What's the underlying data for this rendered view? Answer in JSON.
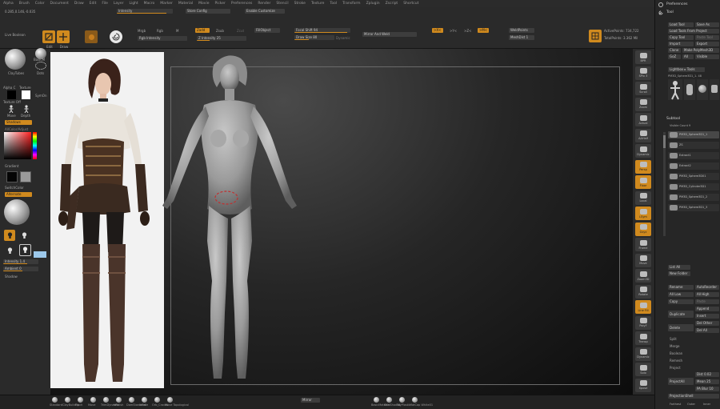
{
  "menu": {
    "items": [
      "Alpha",
      "Brush",
      "Color",
      "Document",
      "Draw",
      "Edit",
      "File",
      "Layer",
      "Light",
      "Macro",
      "Marker",
      "Material",
      "Movie",
      "Picker",
      "Preferences",
      "Render",
      "Stencil",
      "Stroke",
      "Texture",
      "Tool",
      "Transform",
      "Zplugin",
      "Zscript",
      "Shortcut"
    ]
  },
  "shelf": {
    "coords": "0.285,0.146,-0.035",
    "zintensity_label": "Intensity",
    "config_label": "Store Config",
    "enable_customize": "Enable Customize",
    "edit_label": "Edit",
    "draw_label": "Draw",
    "mrgb": "Mrgb",
    "rgb": "Rgb",
    "m": "M",
    "zadd": "Zadd",
    "zsub": "Zsub",
    "zcut": "Zcut",
    "fill_object": "FillObject",
    "rgb_intensity": "Rgb Intensity",
    "z_intensity": "Z Intensity 25",
    "focal_shift": "Focal Shift 94",
    "draw_size": "Draw Size 80",
    "dynamic": "Dynamic",
    "mirror_weld": "Mirror And Weld",
    "x_sym": ">X<",
    "y_sym": ">Y<",
    "z_sym": ">Z<",
    "m_sym": ">M<",
    "active_points": "ActivePoints: 734,722",
    "total_points": "TotalPoints: 3.362 Mil",
    "weld_points": "WeldPoints",
    "mesh_dist": "MeshDist 1"
  },
  "lefttray": {
    "live_boolean": "Live Boolean",
    "brush_label": "ClayTubes",
    "brush_alt": "BasicM",
    "dots": "Dots",
    "alpha_label": "Alpha C",
    "texture_label": "Texture",
    "texture_off": "Texture Off",
    "sym_on": "SymOn",
    "move_label": "Move",
    "depth_label": "Depth",
    "shadows_label": "Shadows",
    "gradient_label": "Gradient",
    "switch_color": "SwitchColor",
    "alternate": "Alternate",
    "intensity_bar": "Intensity 1.4",
    "ambient": "Ambient 0",
    "shadow": "Shadow"
  },
  "righttray": {
    "preferences": "Preferences",
    "tool": "Tool",
    "load_tool": "Load Tool",
    "save_as": "Save As",
    "load_tools_project": "Load Tools From Project",
    "copy_tool": "Copy Tool",
    "paste_tool": "Paste Tool",
    "import": "Import",
    "export": "Export",
    "clone": "Clone",
    "make_polymesh": "Make PolyMesh3D",
    "goz": "GoZ",
    "all": "All",
    "visible": "Visible",
    "lightbox_tools": "Lightbox ▸ Tools",
    "current_tool": "PM3D_Sphere3D1_1. 48",
    "subtool": "Subtool",
    "visible_count": "Visible Count 9",
    "subtools": [
      "PM3D_Sphere3D1_1",
      "ZS",
      "Extract1",
      "Extract2",
      "PM3D_Sphere3D01",
      "PM3D_Cylinder3D1",
      "PM3D_Sphere3D1_2",
      "PM3D_Sphere3D1_3"
    ],
    "list_all": "List All",
    "new_folder": "New Folder",
    "rename": "Rename",
    "auto_reorder": "AutoReorder",
    "all_low": "All Low",
    "all_high": "All High",
    "copy": "Copy",
    "paste": "Paste",
    "append": "Append",
    "duplicate": "Duplicate",
    "insert": "Insert",
    "del_other": "Del Other",
    "delete": "Delete",
    "del_all": "Del All",
    "split": "Split",
    "merge": "Merge",
    "boolean": "Boolean",
    "remesh": "Remesh",
    "project": "Project",
    "project_all": "ProjectAll",
    "dist": "Dist 0.02",
    "mean": "Mean 25",
    "pa_blur": "PA Blur 10",
    "projection_shell": "ProjectionShell",
    "farthest": "Farthest",
    "outer": "Outer",
    "inner": "Inner"
  },
  "rightshelf": [
    "BPR",
    "SPix 3",
    "Scroll",
    "Zoom",
    "Actual",
    "AAHalf",
    "Dynamic",
    "Persp",
    "Floor",
    "Local",
    "LSym",
    "Gxyz",
    "Frame",
    "Move",
    "Zoom3D",
    "Rotate",
    "Line Fill",
    "PolyF",
    "Transp",
    "Dynamic",
    "Solo",
    "Xpose"
  ],
  "bottom": {
    "brushes": [
      "Standard",
      "ClayBuildup",
      "Pinch",
      "Move",
      "TrimDynamic",
      "hPolish",
      "DamStandard",
      "Inflate",
      "Orb_Cracks",
      "Move Topological"
    ],
    "mid_label": "Mirror",
    "right_brushes": [
      "BasicMaterial",
      "SkinShade4",
      "ToyPlastic",
      "MatCap White01"
    ]
  },
  "colors": {
    "accent": "#d08a1e",
    "panel": "#2a2a2a",
    "canvas_dark": "#0c0c0c"
  }
}
